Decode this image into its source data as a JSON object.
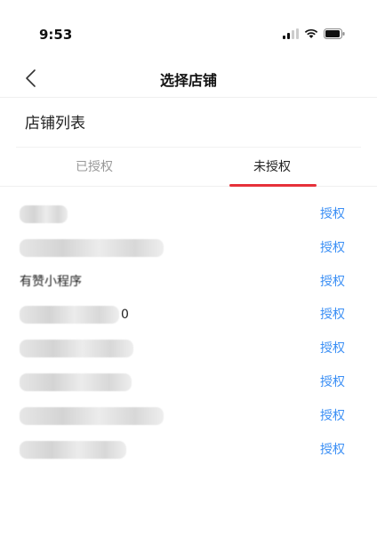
{
  "status": {
    "time": "9:53"
  },
  "nav": {
    "title": "选择店铺",
    "back_icon": "chevron-left-icon"
  },
  "section": {
    "title": "店铺列表"
  },
  "tabs": [
    {
      "label": "已授权",
      "active": false
    },
    {
      "label": "未授权",
      "active": true
    }
  ],
  "stores": [
    {
      "name": "",
      "action": "授权"
    },
    {
      "name": "",
      "action": "授权"
    },
    {
      "name": "有赞小程序",
      "action": "授权"
    },
    {
      "name": "0",
      "action": "授权"
    },
    {
      "name": "",
      "action": "授权"
    },
    {
      "name": "",
      "action": "授权"
    },
    {
      "name": "",
      "action": "授权"
    },
    {
      "name": "",
      "action": "授权"
    }
  ],
  "colors": {
    "accent": "#e6313a",
    "link": "#3b8ff5"
  }
}
